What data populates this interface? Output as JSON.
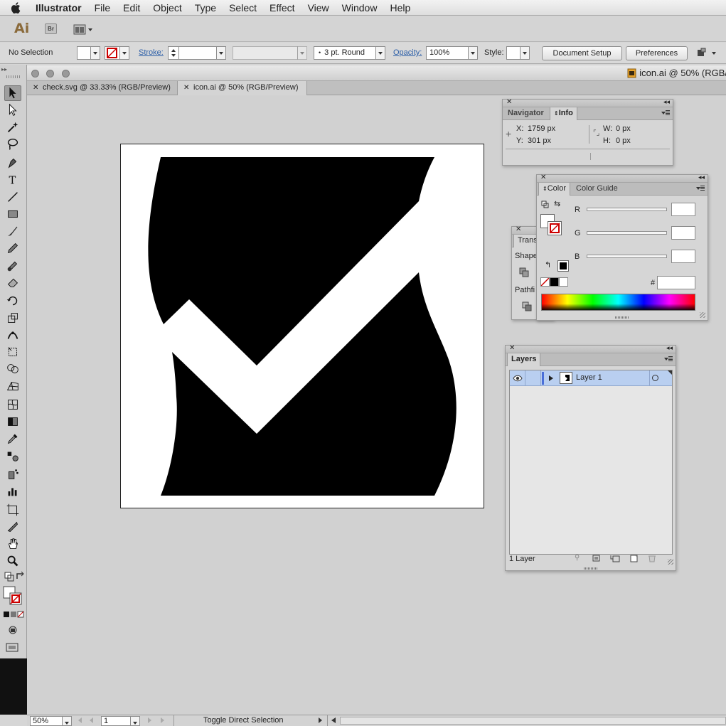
{
  "menubar": {
    "app_name": "Illustrator",
    "items": [
      "File",
      "Edit",
      "Object",
      "Type",
      "Select",
      "Effect",
      "View",
      "Window",
      "Help"
    ]
  },
  "appbar": {
    "logo": "Ai",
    "bridge_label": "Br"
  },
  "control_bar": {
    "selection_status": "No Selection",
    "stroke_label": "Stroke:",
    "stroke_weight": "",
    "brush_profile": "3 pt. Round",
    "opacity_label": "Opacity:",
    "opacity_value": "100%",
    "style_label": "Style:",
    "document_setup_label": "Document Setup",
    "preferences_label": "Preferences"
  },
  "document": {
    "window_title": "icon.ai @ 50% (RGB/",
    "tabs": [
      {
        "label": "check.svg @ 33.33% (RGB/Preview)",
        "active": false
      },
      {
        "label": "icon.ai @ 50% (RGB/Preview)",
        "active": true
      }
    ]
  },
  "toolbox": {
    "tools": [
      "selection-tool",
      "direct-selection-tool",
      "magic-wand-tool",
      "lasso-tool",
      "pen-tool",
      "type-tool",
      "line-segment-tool",
      "rectangle-tool",
      "paintbrush-tool",
      "pencil-tool",
      "blob-brush-tool",
      "eraser-tool",
      "rotate-tool",
      "scale-tool",
      "width-tool",
      "free-transform-tool",
      "shape-builder-tool",
      "perspective-grid-tool",
      "mesh-tool",
      "gradient-tool",
      "eyedropper-tool",
      "blend-tool",
      "symbol-sprayer-tool",
      "column-graph-tool",
      "artboard-tool",
      "slice-tool",
      "hand-tool",
      "zoom-tool"
    ]
  },
  "navigator_info_panel": {
    "tabs": [
      "Navigator",
      "Info"
    ],
    "active_tab": "Info",
    "x_label": "X:",
    "x_value": "1759 px",
    "y_label": "Y:",
    "y_value": "301 px",
    "w_label": "W:",
    "w_value": "0 px",
    "h_label": "H:",
    "h_value": "0 px"
  },
  "transform_panel": {
    "tab_label": "Trans",
    "shape_label": "Shape",
    "pathfinder_label": "Pathfi"
  },
  "color_panel": {
    "tabs": [
      "Color",
      "Color Guide"
    ],
    "active_tab": "Color",
    "r_label": "R",
    "r_value": "",
    "g_label": "G",
    "g_value": "",
    "b_label": "B",
    "b_value": "",
    "hex_label": "#",
    "hex_value": ""
  },
  "layers_panel": {
    "tab_label": "Layers",
    "layers": [
      {
        "name": "Layer 1",
        "visible": true
      }
    ],
    "footer_count": "1 Layer"
  },
  "statusbar": {
    "zoom": "50%",
    "artboard_number": "1",
    "status_text": "Toggle Direct Selection"
  },
  "colors": {
    "accent_link": "#2d5fa8",
    "layer_highlight": "#b9cff0",
    "layer_color_bar": "#4a6fd8"
  }
}
